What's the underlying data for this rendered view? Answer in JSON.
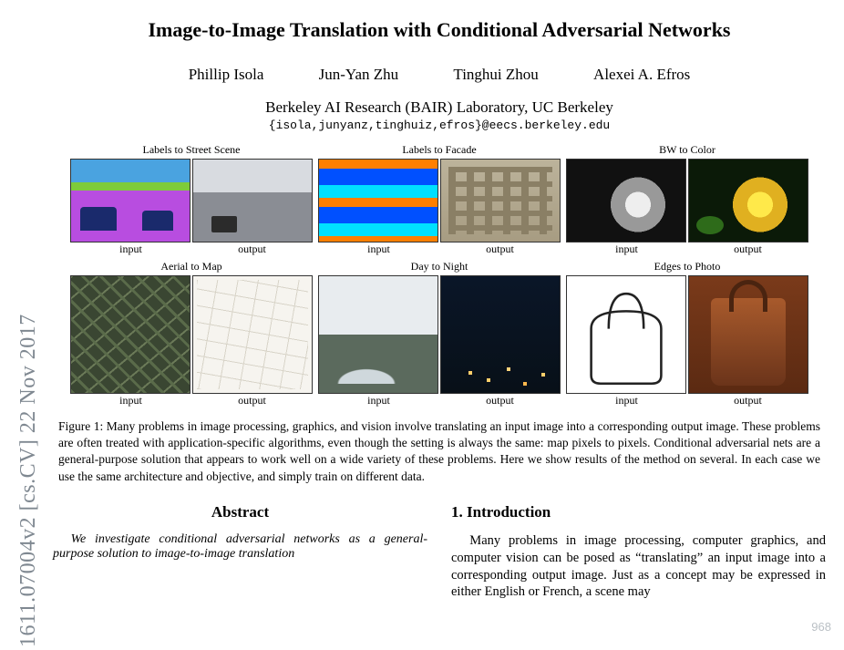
{
  "arxiv_stamp": "1611.07004v2  [cs.CV]  22 Nov 2017",
  "title": "Image-to-Image Translation with Conditional Adversarial Networks",
  "authors": [
    "Phillip Isola",
    "Jun-Yan Zhu",
    "Tinghui Zhou",
    "Alexei A. Efros"
  ],
  "affiliation": "Berkeley AI Research (BAIR) Laboratory, UC Berkeley",
  "email": "{isola,junyanz,tinghuiz,efros}@eecs.berkeley.edu",
  "figure": {
    "examples": [
      {
        "title": "Labels to Street Scene",
        "input_label": "input",
        "output_label": "output"
      },
      {
        "title": "Labels to Facade",
        "input_label": "input",
        "output_label": "output"
      },
      {
        "title": "BW to Color",
        "input_label": "input",
        "output_label": "output"
      },
      {
        "title": "Aerial to Map",
        "input_label": "input",
        "output_label": "output"
      },
      {
        "title": "Day to Night",
        "input_label": "input",
        "output_label": "output"
      },
      {
        "title": "Edges to Photo",
        "input_label": "input",
        "output_label": "output"
      }
    ],
    "caption": "Figure 1: Many problems in image processing, graphics, and vision involve translating an input image into a corresponding output image. These problems are often treated with application-specific algorithms, even though the setting is always the same: map pixels to pixels. Conditional adversarial nets are a general-purpose solution that appears to work well on a wide variety of these problems. Here we show results of the method on several. In each case we use the same architecture and objective, and simply train on different data."
  },
  "abstract": {
    "heading": "Abstract",
    "body": "We investigate conditional adversarial networks as a general-purpose solution to image-to-image translation"
  },
  "intro": {
    "heading": "1. Introduction",
    "body": "Many problems in image processing, computer graphics, and computer vision can be posed as “translating” an input image into a corresponding output image. Just as a concept may be expressed in either English or French, a scene may"
  },
  "watermark": "968"
}
